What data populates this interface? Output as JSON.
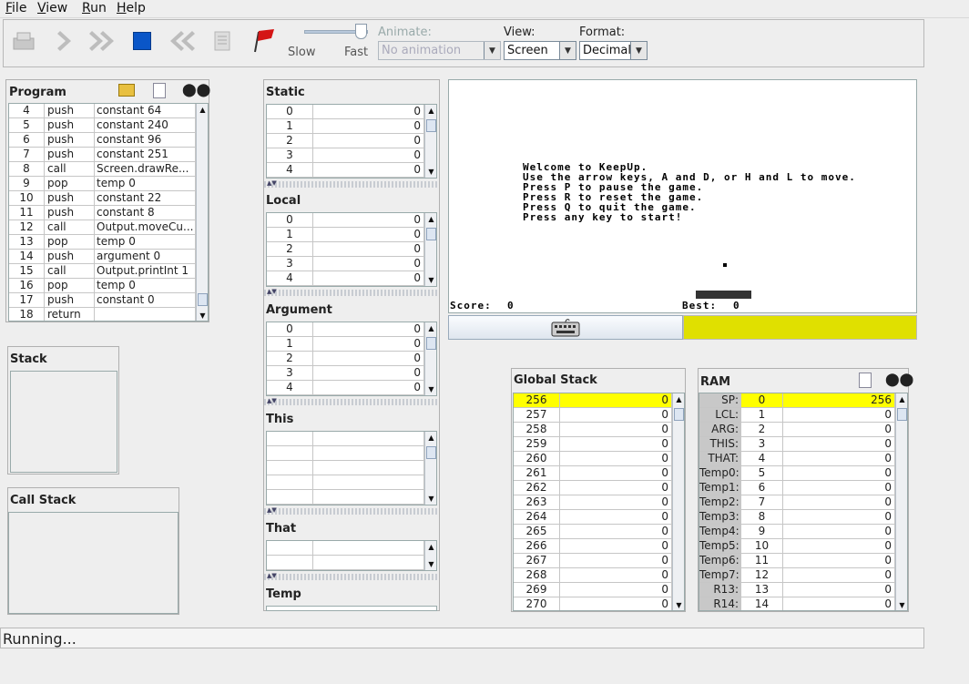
{
  "menubar": {
    "items": [
      "File",
      "View",
      "Run",
      "Help"
    ]
  },
  "toolbar": {
    "slider": {
      "slow_label": "Slow",
      "fast_label": "Fast",
      "speed_fraction": 0.85
    },
    "animate": {
      "label": "Animate:",
      "value": "No animation"
    },
    "view": {
      "label": "View:",
      "value": "Screen"
    },
    "format": {
      "label": "Format:",
      "value": "Decimal"
    }
  },
  "program": {
    "title": "Program",
    "rows": [
      [
        "4",
        "push",
        "constant 64"
      ],
      [
        "5",
        "push",
        "constant 240"
      ],
      [
        "6",
        "push",
        "constant 96"
      ],
      [
        "7",
        "push",
        "constant 251"
      ],
      [
        "8",
        "call",
        "Screen.drawRe..."
      ],
      [
        "9",
        "pop",
        "temp 0"
      ],
      [
        "10",
        "push",
        "constant 22"
      ],
      [
        "11",
        "push",
        "constant 8"
      ],
      [
        "12",
        "call",
        "Output.moveCu..."
      ],
      [
        "13",
        "pop",
        "temp 0"
      ],
      [
        "14",
        "push",
        "argument 0"
      ],
      [
        "15",
        "call",
        "Output.printInt 1"
      ],
      [
        "16",
        "pop",
        "temp 0"
      ],
      [
        "17",
        "push",
        "constant 0"
      ],
      [
        "18",
        "return",
        ""
      ]
    ]
  },
  "stack": {
    "title": "Stack"
  },
  "callstack": {
    "title": "Call Stack"
  },
  "segments": {
    "static": {
      "title": "Static",
      "rows": [
        [
          "0",
          "0"
        ],
        [
          "1",
          "0"
        ],
        [
          "2",
          "0"
        ],
        [
          "3",
          "0"
        ],
        [
          "4",
          "0"
        ]
      ]
    },
    "local": {
      "title": "Local",
      "rows": [
        [
          "0",
          "0"
        ],
        [
          "1",
          "0"
        ],
        [
          "2",
          "0"
        ],
        [
          "3",
          "0"
        ],
        [
          "4",
          "0"
        ]
      ]
    },
    "argument": {
      "title": "Argument",
      "rows": [
        [
          "0",
          "0"
        ],
        [
          "1",
          "0"
        ],
        [
          "2",
          "0"
        ],
        [
          "3",
          "0"
        ],
        [
          "4",
          "0"
        ]
      ]
    },
    "this": {
      "title": "This"
    },
    "that": {
      "title": "That"
    },
    "temp": {
      "title": "Temp"
    }
  },
  "screen": {
    "lines": [
      "Welcome to KeepUp.",
      "Use the arrow keys, A and D, or H and L to move.",
      "Press P to pause the game.",
      "Press R to reset the game.",
      "Press Q to quit the game.",
      "Press any key to start!"
    ],
    "score_label": "Score:",
    "score_value": "0",
    "best_label": "Best:",
    "best_value": "0"
  },
  "keyboard": {
    "icon": "keyboard-icon",
    "highlight_color": "#e0e000"
  },
  "global_stack": {
    "title": "Global Stack",
    "rows": [
      [
        "256",
        "0"
      ],
      [
        "257",
        "0"
      ],
      [
        "258",
        "0"
      ],
      [
        "259",
        "0"
      ],
      [
        "260",
        "0"
      ],
      [
        "261",
        "0"
      ],
      [
        "262",
        "0"
      ],
      [
        "263",
        "0"
      ],
      [
        "264",
        "0"
      ],
      [
        "265",
        "0"
      ],
      [
        "266",
        "0"
      ],
      [
        "267",
        "0"
      ],
      [
        "268",
        "0"
      ],
      [
        "269",
        "0"
      ],
      [
        "270",
        "0"
      ]
    ]
  },
  "ram": {
    "title": "RAM",
    "rows": [
      [
        "SP:",
        "0",
        "256"
      ],
      [
        "LCL:",
        "1",
        "0"
      ],
      [
        "ARG:",
        "2",
        "0"
      ],
      [
        "THIS:",
        "3",
        "0"
      ],
      [
        "THAT:",
        "4",
        "0"
      ],
      [
        "Temp0:",
        "5",
        "0"
      ],
      [
        "Temp1:",
        "6",
        "0"
      ],
      [
        "Temp2:",
        "7",
        "0"
      ],
      [
        "Temp3:",
        "8",
        "0"
      ],
      [
        "Temp4:",
        "9",
        "0"
      ],
      [
        "Temp5:",
        "10",
        "0"
      ],
      [
        "Temp6:",
        "11",
        "0"
      ],
      [
        "Temp7:",
        "12",
        "0"
      ],
      [
        "R13:",
        "13",
        "0"
      ],
      [
        "R14:",
        "14",
        "0"
      ]
    ]
  },
  "status": {
    "text": "Running..."
  },
  "colors": {
    "highlight": "#ffff00",
    "accent_red": "#cc1111",
    "stop_blue": "#0a56c8"
  }
}
